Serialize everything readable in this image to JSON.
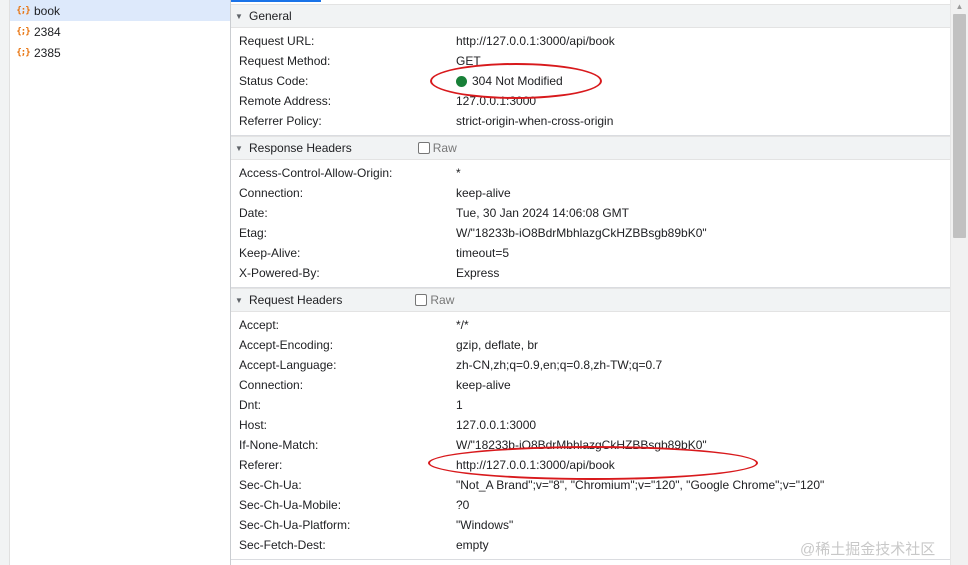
{
  "sidebar": {
    "items": [
      {
        "name": "book",
        "selected": true
      },
      {
        "name": "2384"
      },
      {
        "name": "2385"
      }
    ]
  },
  "icons": {
    "request": "json-braces-icon",
    "raw_checkbox": "checkbox-icon"
  },
  "colors": {
    "status_ok": "#188038",
    "selected_row": "#dde9fb",
    "annotation": "#d8191c",
    "section_bg": "#f1f3f4"
  },
  "general": {
    "title": "General",
    "rows": [
      {
        "k": "Request URL:",
        "v": "http://127.0.0.1:3000/api/book"
      },
      {
        "k": "Request Method:",
        "v": "GET"
      },
      {
        "k": "Status Code:",
        "v": "304 Not Modified"
      },
      {
        "k": "Remote Address:",
        "v": "127.0.0.1:3000"
      },
      {
        "k": "Referrer Policy:",
        "v": "strict-origin-when-cross-origin"
      }
    ]
  },
  "response": {
    "title": "Response Headers",
    "raw": "Raw",
    "rows": [
      {
        "k": "Access-Control-Allow-Origin:",
        "v": "*"
      },
      {
        "k": "Connection:",
        "v": "keep-alive"
      },
      {
        "k": "Date:",
        "v": "Tue, 30 Jan 2024 14:06:08 GMT"
      },
      {
        "k": "Etag:",
        "v": "W/\"18233b-iO8BdrMbhlazgCkHZBBsgb89bK0\""
      },
      {
        "k": "Keep-Alive:",
        "v": "timeout=5"
      },
      {
        "k": "X-Powered-By:",
        "v": "Express"
      }
    ]
  },
  "request": {
    "title": "Request Headers",
    "raw": "Raw",
    "rows": [
      {
        "k": "Accept:",
        "v": "*/*"
      },
      {
        "k": "Accept-Encoding:",
        "v": "gzip, deflate, br"
      },
      {
        "k": "Accept-Language:",
        "v": "zh-CN,zh;q=0.9,en;q=0.8,zh-TW;q=0.7"
      },
      {
        "k": "Connection:",
        "v": "keep-alive"
      },
      {
        "k": "Dnt:",
        "v": "1"
      },
      {
        "k": "Host:",
        "v": "127.0.0.1:3000"
      },
      {
        "k": "If-None-Match:",
        "v": "W/\"18233b-iO8BdrMbhlazgCkHZBBsgb89bK0\""
      },
      {
        "k": "Referer:",
        "v": "http://127.0.0.1:3000/api/book"
      },
      {
        "k": "Sec-Ch-Ua:",
        "v": "\"Not_A Brand\";v=\"8\", \"Chromium\";v=\"120\", \"Google Chrome\";v=\"120\""
      },
      {
        "k": "Sec-Ch-Ua-Mobile:",
        "v": "?0"
      },
      {
        "k": "Sec-Ch-Ua-Platform:",
        "v": "\"Windows\""
      },
      {
        "k": "Sec-Fetch-Dest:",
        "v": "empty"
      }
    ]
  },
  "watermark": "@稀土掘金技术社区"
}
